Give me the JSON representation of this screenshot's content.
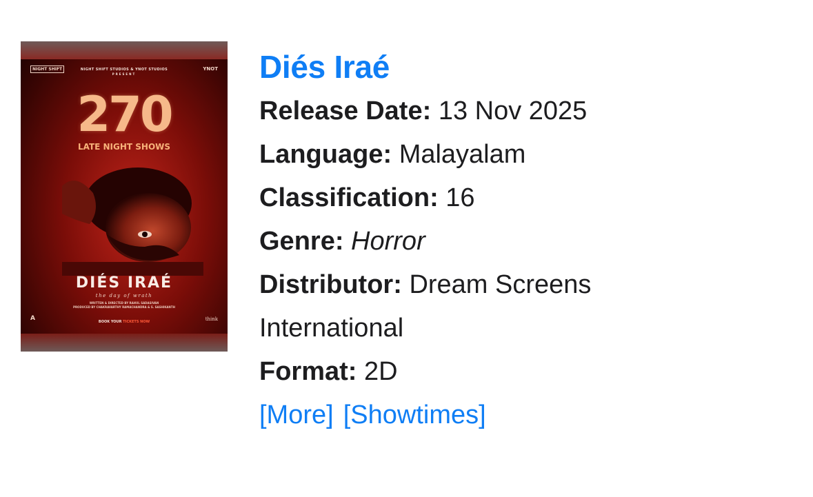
{
  "poster": {
    "studios_line": "NIGHT SHIFT STUDIOS & YNOT STUDIOS",
    "present": "PRESENT",
    "logo_left": "NIGHT SHIFT",
    "logo_right": "YNOT",
    "big_number": "270",
    "shows_text": "LATE NIGHT SHOWS",
    "title": "DIÉS IRAÉ",
    "tagline": "the day of wrath",
    "credits_line1": "WRITTEN & DIRECTED BY RAHUL SADASIVAN",
    "credits_line2": "PRODUCED BY CHAKRAVARTHY RAMACHANDRA & S. SASHIKANTH",
    "book_prefix": "BOOK YOUR",
    "book_highlight": "TICKETS NOW",
    "mini_left": "A",
    "mini_right": "think"
  },
  "movie": {
    "title": "Diés Iraé",
    "release_label": "Release Date:",
    "release_value": "13 Nov 2025",
    "language_label": "Language:",
    "language_value": "Malayalam",
    "classification_label": "Classification:",
    "classification_value": "16",
    "genre_label": "Genre:",
    "genre_value": "Horror",
    "distributor_label": "Distributor:",
    "distributor_value_line1": "Dream Screens",
    "distributor_value_line2": "International",
    "format_label": "Format:",
    "format_value": "2D"
  },
  "links": {
    "more": "[More]",
    "showtimes": "[Showtimes]"
  },
  "colors": {
    "link": "#0f7ef5",
    "text": "#1d1d1f",
    "poster_red": "#7a0d08"
  }
}
